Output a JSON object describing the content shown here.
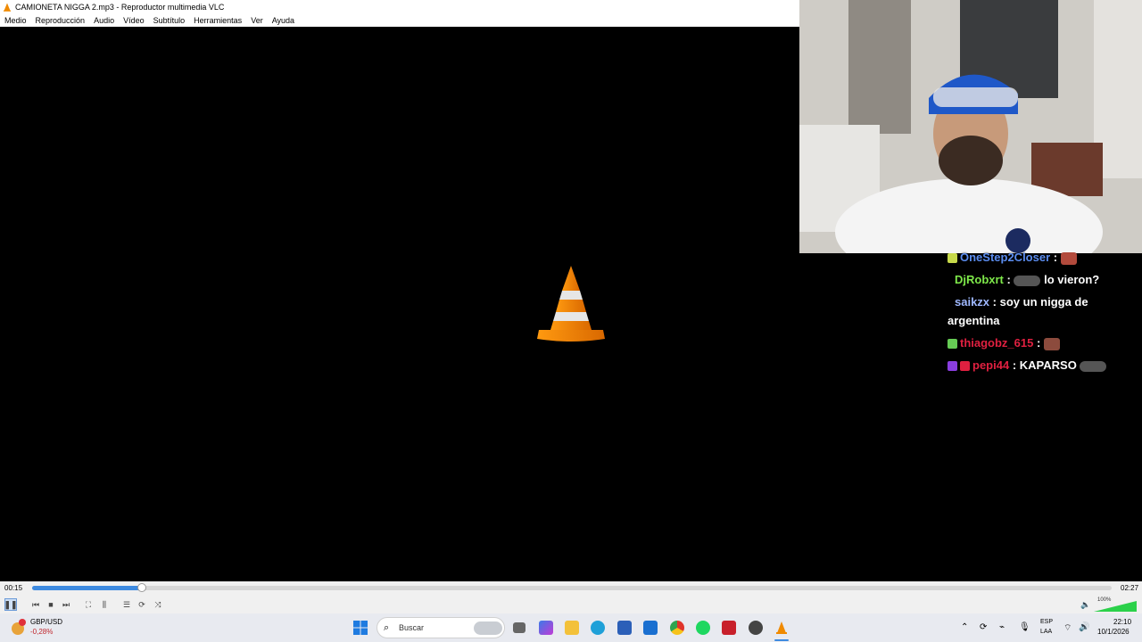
{
  "window": {
    "title": "CAMIONETA NIGGA 2.mp3 - Reproductor multimedia VLC",
    "menu": [
      "Medio",
      "Reproducción",
      "Audio",
      "Vídeo",
      "Subtítulo",
      "Herramientas",
      "Ver",
      "Ayuda"
    ]
  },
  "chat": {
    "messages": [
      {
        "user": "OneStep2Closer",
        "sep": ":",
        "text": "",
        "color": "#5b8df0"
      },
      {
        "user": "DjRobxrt",
        "sep": ":",
        "text": "lo vieron?",
        "color": "#7ee84a"
      },
      {
        "user": "saikzx",
        "sep": ":",
        "text": "soy un nigga de argentina",
        "color": "#9fb8ff"
      },
      {
        "user": "thiagobz_615",
        "sep": ":",
        "text": "",
        "color": "#e02040"
      },
      {
        "user": "pepi44",
        "sep": ":",
        "text": "KAPARSO",
        "color": "#e02040"
      }
    ]
  },
  "player": {
    "elapsed": "00:15",
    "duration": "02:27",
    "progress": 0.102,
    "volume_label": "100%",
    "volume": 1.0
  },
  "taskbar": {
    "widget_pair": "GBP/USD",
    "widget_change": "-0,28%",
    "search_placeholder": "Buscar",
    "lang_top": "ESP",
    "lang_bottom": "LAA",
    "time": "22:10",
    "date": "10/1/2026"
  },
  "colors": {
    "vlc_orange": "#f08a00",
    "seek_blue": "#3d8ae0",
    "accent_green": "#2bd14a"
  },
  "icons": [
    "vlc-cone-icon",
    "play-pause-icon",
    "previous-icon",
    "stop-icon",
    "next-icon",
    "fullscreen-icon",
    "extended-settings-icon",
    "playlist-icon",
    "loop-icon",
    "shuffle-icon",
    "volume-icon",
    "windows-start-icon",
    "search-icon"
  ]
}
